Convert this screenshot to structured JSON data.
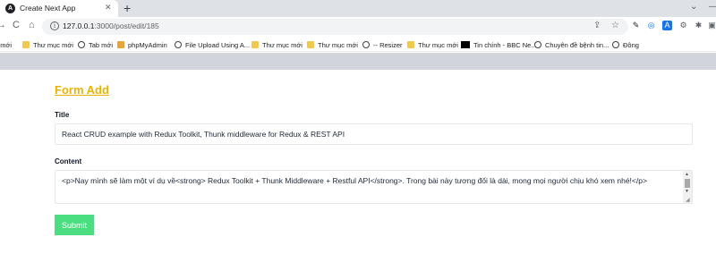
{
  "browser": {
    "tab": {
      "title": "Create Next App",
      "favicon": "A",
      "close": "✕"
    },
    "new_tab": "+",
    "tab_chevron": "⌄",
    "window_minimize": "—",
    "nav": {
      "back": "←",
      "forward": "→",
      "reload": "C",
      "home": "⌂"
    },
    "url": {
      "host": "127.0.0.1",
      "path": ":3000/post/edit/185"
    },
    "info_icon": "i",
    "icons": {
      "share": "⇪",
      "star": "☆",
      "pen": "✎",
      "ring": "◎",
      "translate": "A",
      "gear": "⚙",
      "puzzle": "✱",
      "sidebar": "▣"
    },
    "bookmarks": [
      {
        "label": "g mới",
        "icon": "globe"
      },
      {
        "label": "Thư mục mới",
        "icon": "folder"
      },
      {
        "label": "Tab mới",
        "icon": "globe"
      },
      {
        "label": "phpMyAdmin",
        "icon": "pma"
      },
      {
        "label": "File Upload Using A...",
        "icon": "globe"
      },
      {
        "label": "Thư mục mới",
        "icon": "folder"
      },
      {
        "label": "Thư mục mới",
        "icon": "folder"
      },
      {
        "label": "-- Resizer",
        "icon": "globe"
      },
      {
        "label": "Thư mục mới",
        "icon": "folder"
      },
      {
        "label": "Tin chính - BBC Ne...",
        "icon": "bbc"
      },
      {
        "label": "Chuyên đề bệnh tin...",
        "icon": "globe"
      },
      {
        "label": "Đông",
        "icon": "globe"
      }
    ]
  },
  "form": {
    "heading": "Form Add",
    "title_label": "Title",
    "title_value": "React CRUD example with Redux Toolkit, Thunk middleware for Redux & REST API",
    "content_label": "Content",
    "content_value": "<p>Nay mình sẽ làm một ví dụ về<strong> Redux Toolkit + Thunk Middleware + Restful API</strong>. Trong bài này tương đối là dài, mong mọi người chịu khó xem nhé!</p>",
    "submit_label": "Submit"
  },
  "scrollbar": {
    "up": "▲",
    "down": "▼",
    "resize": "◢"
  },
  "colors": {
    "heading": "#eab308",
    "submit_bg": "#4ade80",
    "strip": "#d1d5db"
  }
}
